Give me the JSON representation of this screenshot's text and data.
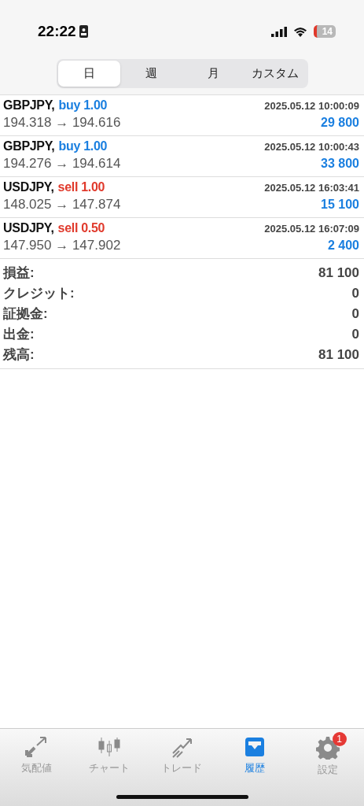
{
  "status_bar": {
    "time": "22:22",
    "battery": "14"
  },
  "period_tabs": [
    {
      "label": "日",
      "selected": true
    },
    {
      "label": "週",
      "selected": false
    },
    {
      "label": "月",
      "selected": false
    },
    {
      "label": "カスタム",
      "selected": false
    }
  ],
  "trades": [
    {
      "symbol": "GBPJPY,",
      "kind": "buy",
      "order": "buy 1.00",
      "time": "2025.05.12 10:00:09",
      "prices": "194.318 → 194.616",
      "profit": "29 800"
    },
    {
      "symbol": "GBPJPY,",
      "kind": "buy",
      "order": "buy 1.00",
      "time": "2025.05.12 10:00:43",
      "prices": "194.276 → 194.614",
      "profit": "33 800"
    },
    {
      "symbol": "USDJPY,",
      "kind": "sell",
      "order": "sell 1.00",
      "time": "2025.05.12 16:03:41",
      "prices": "148.025 → 147.874",
      "profit": "15 100"
    },
    {
      "symbol": "USDJPY,",
      "kind": "sell",
      "order": "sell 0.50",
      "time": "2025.05.12 16:07:09",
      "prices": "147.950 → 147.902",
      "profit": "2 400"
    }
  ],
  "summary": [
    {
      "label": "損益:",
      "value": "81 100"
    },
    {
      "label": "クレジット:",
      "value": "0"
    },
    {
      "label": "証拠金:",
      "value": "0"
    },
    {
      "label": "出金:",
      "value": "0"
    },
    {
      "label": "残高:",
      "value": "81 100"
    }
  ],
  "tab_bar": [
    {
      "kind": "quotes",
      "label": "気配値",
      "selected": false
    },
    {
      "kind": "chart",
      "label": "チャート",
      "selected": false
    },
    {
      "kind": "trade",
      "label": "トレード",
      "selected": false
    },
    {
      "kind": "history",
      "label": "履歴",
      "selected": true
    },
    {
      "kind": "settings",
      "label": "設定",
      "selected": false,
      "badge": "1"
    }
  ]
}
